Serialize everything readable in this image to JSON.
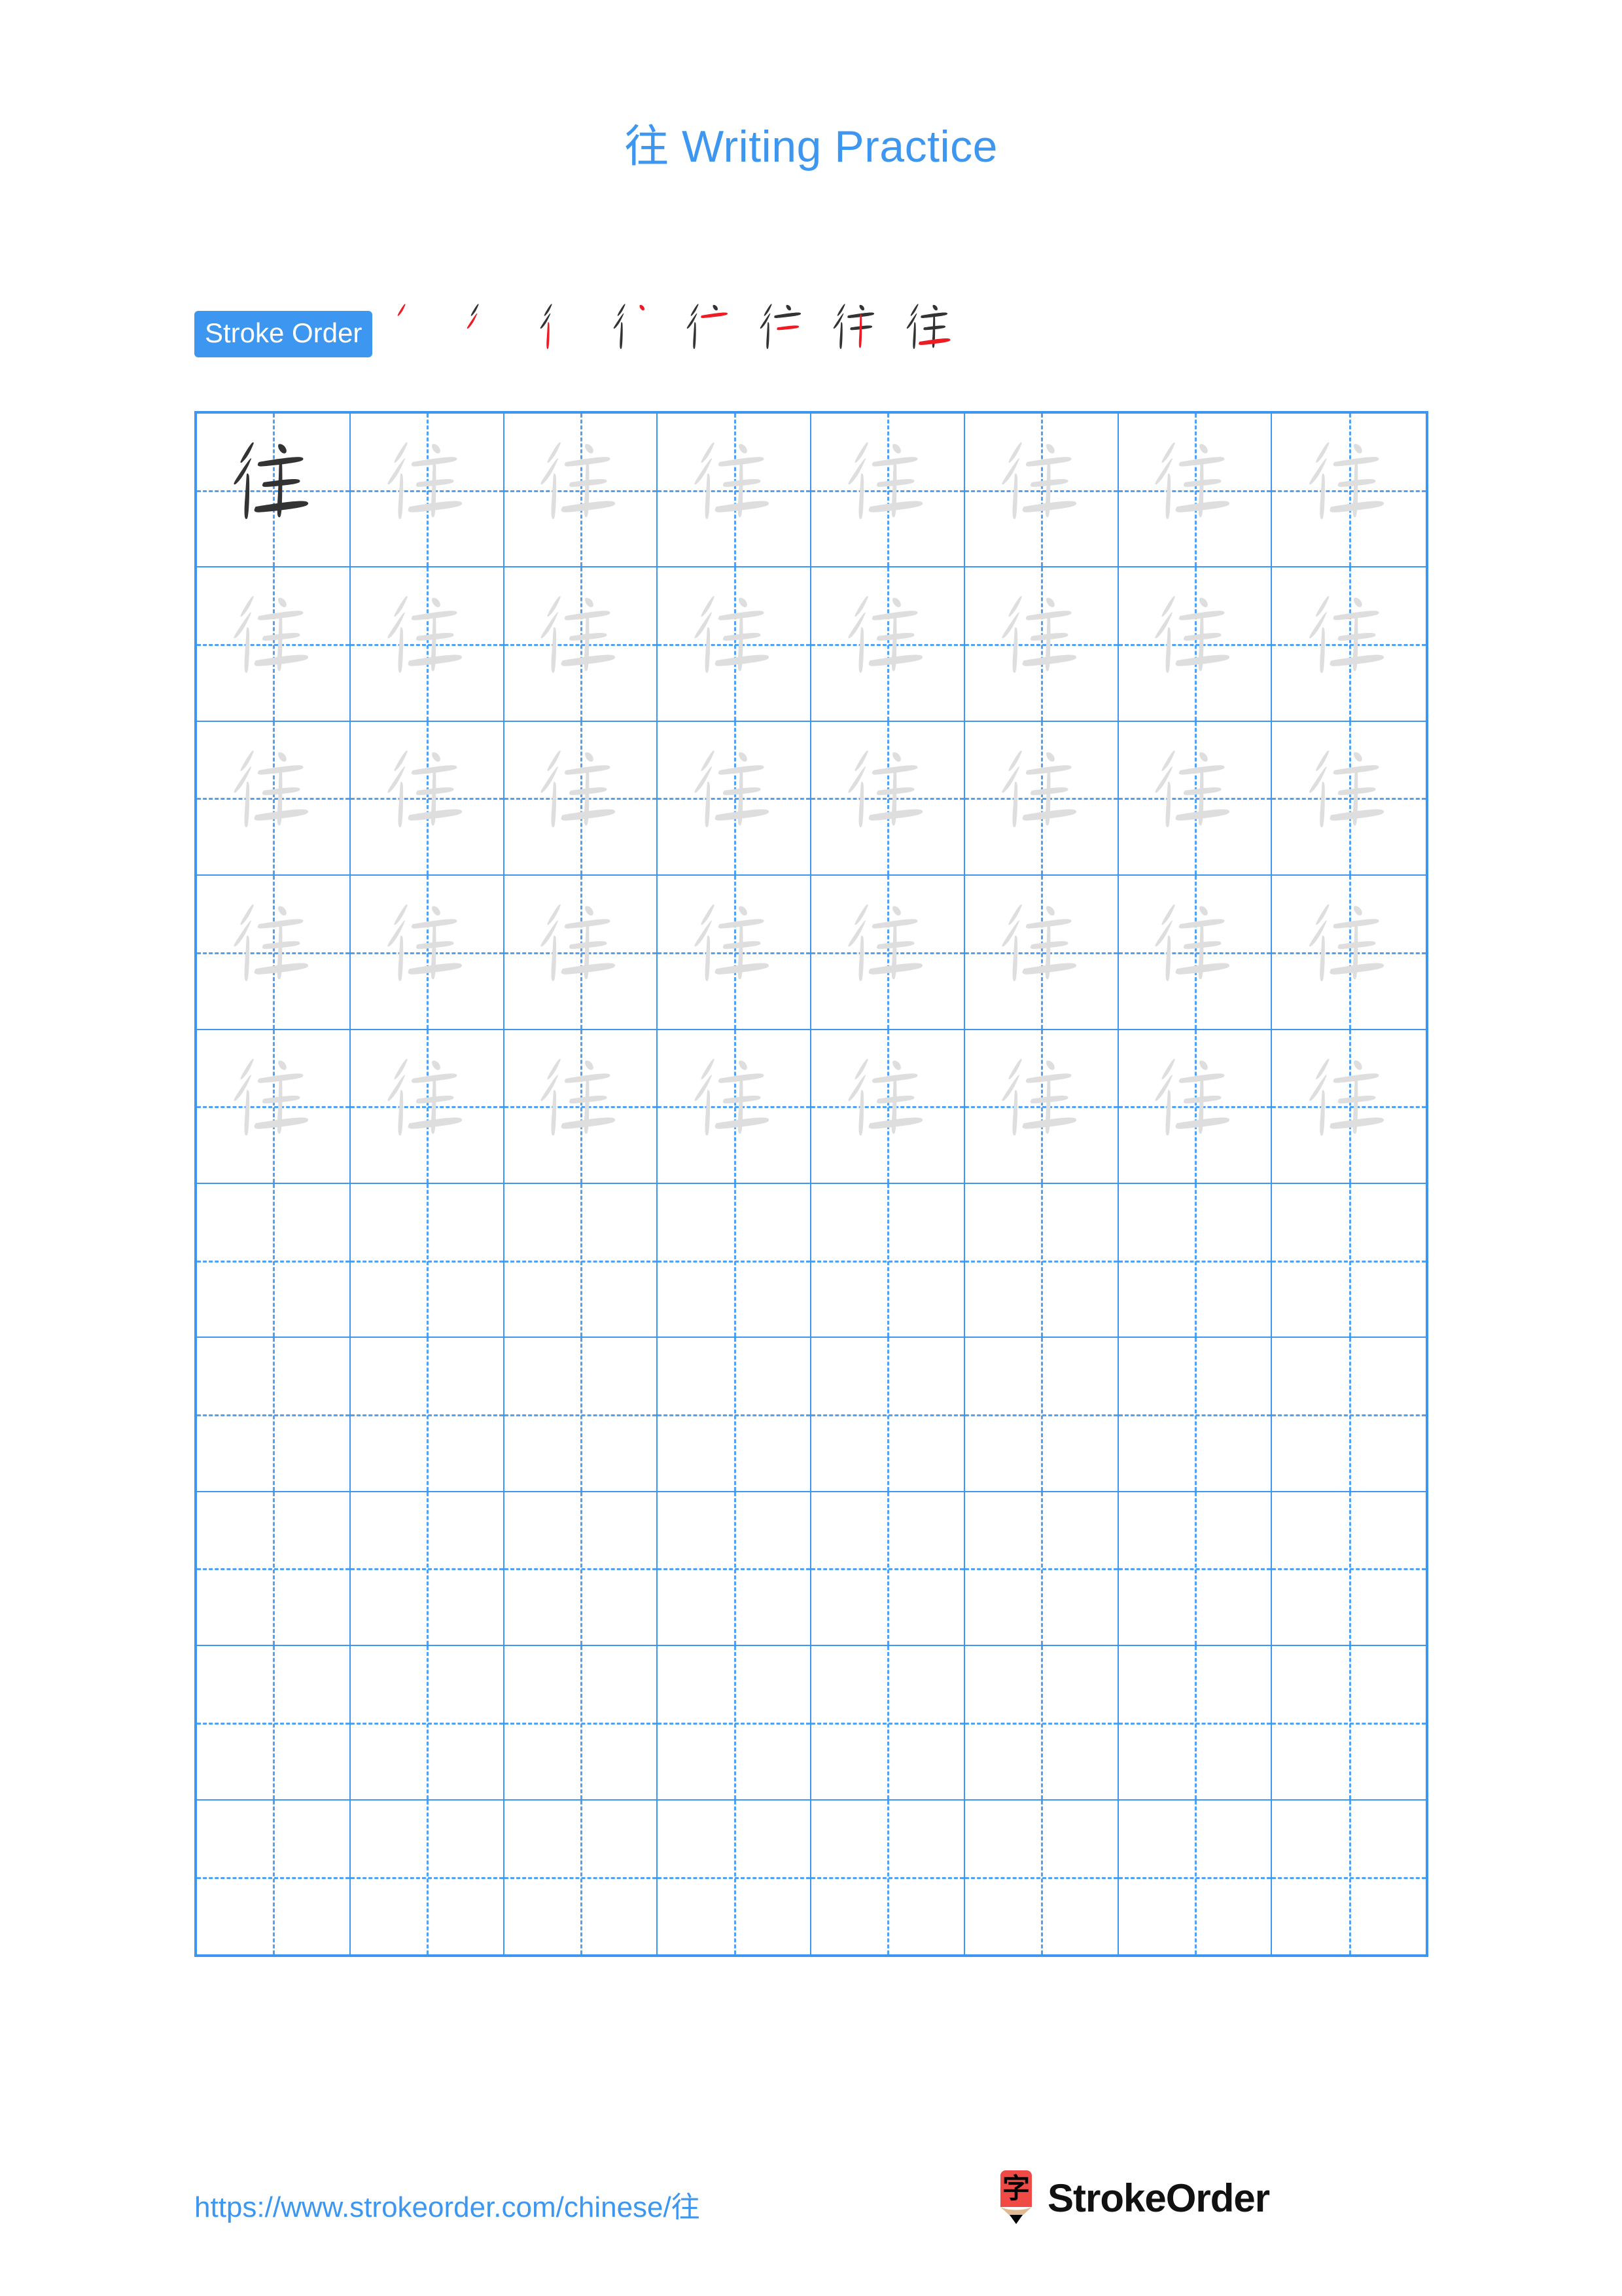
{
  "document": {
    "title": "往 Writing Practice",
    "character": "往",
    "title_character": "往",
    "title_text": "Writing Practice",
    "accent_color": "#3d97f0",
    "grid_line_color": "#4a9cf2",
    "dark_char_color": "#333333",
    "light_char_color": "#dedede",
    "stroke_highlight_color": "#ed1c24"
  },
  "stroke_order": {
    "label": "Stroke Order",
    "total_strokes": 8,
    "steps": [
      {
        "index": 1,
        "strokes_shown": 1,
        "new_stroke": "撇 (piě)"
      },
      {
        "index": 2,
        "strokes_shown": 2,
        "new_stroke": "撇 (piě)"
      },
      {
        "index": 3,
        "strokes_shown": 3,
        "new_stroke": "竖 (shù)"
      },
      {
        "index": 4,
        "strokes_shown": 4,
        "new_stroke": "点 (diǎn)"
      },
      {
        "index": 5,
        "strokes_shown": 5,
        "new_stroke": "横 (héng)"
      },
      {
        "index": 6,
        "strokes_shown": 6,
        "new_stroke": "横 (héng)"
      },
      {
        "index": 7,
        "strokes_shown": 7,
        "new_stroke": "竖 (shù)"
      },
      {
        "index": 8,
        "strokes_shown": 8,
        "new_stroke": "横 (héng)"
      }
    ]
  },
  "practice_grid": {
    "columns": 8,
    "rows": 10,
    "filled_rows": 5,
    "empty_rows": 5,
    "cells": [
      [
        "dark",
        "light",
        "light",
        "light",
        "light",
        "light",
        "light",
        "light"
      ],
      [
        "light",
        "light",
        "light",
        "light",
        "light",
        "light",
        "light",
        "light"
      ],
      [
        "light",
        "light",
        "light",
        "light",
        "light",
        "light",
        "light",
        "light"
      ],
      [
        "light",
        "light",
        "light",
        "light",
        "light",
        "light",
        "light",
        "light"
      ],
      [
        "light",
        "light",
        "light",
        "light",
        "light",
        "light",
        "light",
        "light"
      ],
      [
        "empty",
        "empty",
        "empty",
        "empty",
        "empty",
        "empty",
        "empty",
        "empty"
      ],
      [
        "empty",
        "empty",
        "empty",
        "empty",
        "empty",
        "empty",
        "empty",
        "empty"
      ],
      [
        "empty",
        "empty",
        "empty",
        "empty",
        "empty",
        "empty",
        "empty",
        "empty"
      ],
      [
        "empty",
        "empty",
        "empty",
        "empty",
        "empty",
        "empty",
        "empty",
        "empty"
      ],
      [
        "empty",
        "empty",
        "empty",
        "empty",
        "empty",
        "empty",
        "empty",
        "empty"
      ]
    ]
  },
  "footer": {
    "url": "https://www.strokeorder.com/chinese/往",
    "brand_name": "StrokeOrder",
    "logo_character": "字",
    "logo_body_color": "#ef4a46",
    "logo_wood_color": "#e0b992",
    "logo_tip_color": "#000000"
  }
}
